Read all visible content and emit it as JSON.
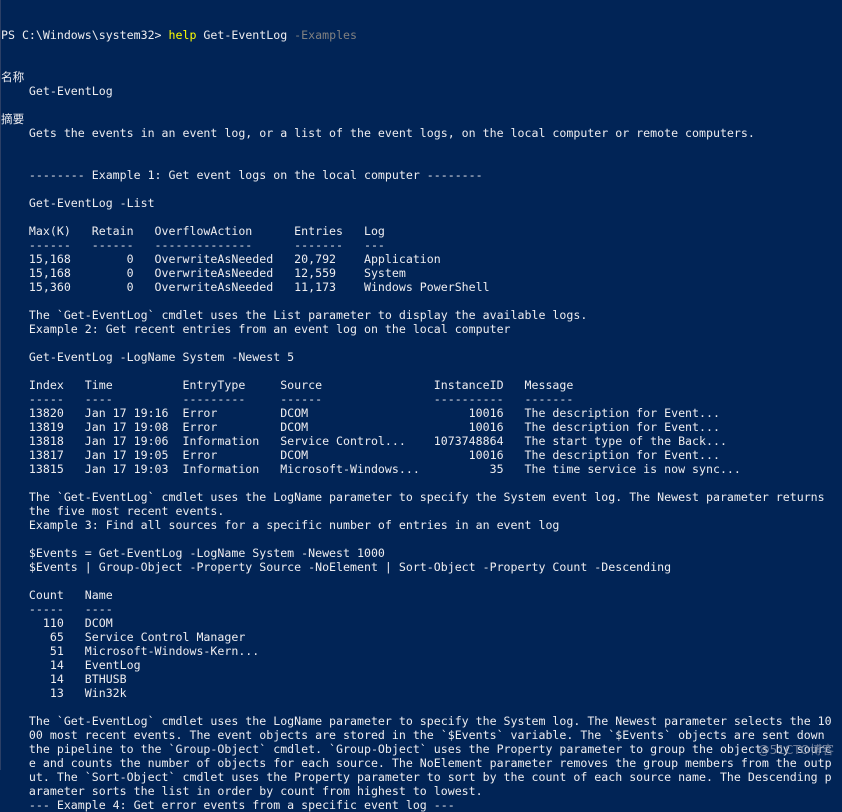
{
  "prompt": {
    "path": "PS C:\\Windows\\system32> ",
    "command": "help",
    "args": " Get-EventLog",
    "param": " -Examples"
  },
  "lines": [
    "",
    "名称",
    "    Get-EventLog",
    "",
    "摘要",
    "    Gets the events in an event log, or a list of the event logs, on the local computer or remote computers.",
    "",
    "",
    "    -------- Example 1: Get event logs on the local computer --------",
    "",
    "    Get-EventLog -List",
    "",
    "    Max(K)   Retain   OverflowAction      Entries   Log",
    "    ------   ------   --------------      -------   ---",
    "    15,168        0   OverwriteAsNeeded   20,792    Application",
    "    15,168        0   OverwriteAsNeeded   12,559    System",
    "    15,360        0   OverwriteAsNeeded   11,173    Windows PowerShell",
    "",
    "    The `Get-EventLog` cmdlet uses the List parameter to display the available logs.",
    "    Example 2: Get recent entries from an event log on the local computer",
    "",
    "    Get-EventLog -LogName System -Newest 5",
    "",
    "    Index   Time          EntryType     Source                InstanceID   Message",
    "    -----   ----          ---------     ------                ----------   -------",
    "    13820   Jan 17 19:16  Error         DCOM                       10016   The description for Event...",
    "    13819   Jan 17 19:08  Error         DCOM                       10016   The description for Event...",
    "    13818   Jan 17 19:06  Information   Service Control...    1073748864   The start type of the Back...",
    "    13817   Jan 17 19:05  Error         DCOM                       10016   The description for Event...",
    "    13815   Jan 17 19:03  Information   Microsoft-Windows...          35   The time service is now sync...",
    "",
    "    The `Get-EventLog` cmdlet uses the LogName parameter to specify the System event log. The Newest parameter returns",
    "    the five most recent events.",
    "    Example 3: Find all sources for a specific number of entries in an event log",
    "",
    "    $Events = Get-EventLog -LogName System -Newest 1000",
    "    $Events | Group-Object -Property Source -NoElement | Sort-Object -Property Count -Descending",
    "",
    "    Count   Name",
    "    -----   ----",
    "      110   DCOM",
    "       65   Service Control Manager",
    "       51   Microsoft-Windows-Kern...",
    "       14   EventLog",
    "       14   BTHUSB",
    "       13   Win32k",
    "",
    "    The `Get-EventLog` cmdlet uses the LogName parameter to specify the System log. The Newest parameter selects the 10",
    "    00 most recent events. The event objects are stored in the `$Events` variable. The `$Events` objects are sent down",
    "    the pipeline to the `Group-Object` cmdlet. `Group-Object` uses the Property parameter to group the objects by sourc",
    "    e and counts the number of objects for each source. The NoElement parameter removes the group members from the outp",
    "    ut. The `Sort-Object` cmdlet uses the Property parameter to sort by the count of each source name. The Descending p",
    "    arameter sorts the list in order by count from highest to lowest.",
    "    --- Example 4: Get error events from a specific event log ---"
  ],
  "watermark": "@51CTO博客",
  "colors": {
    "background": "#012456",
    "text": "#eeedf0",
    "command": "#ffff00",
    "parameter": "#808080"
  }
}
